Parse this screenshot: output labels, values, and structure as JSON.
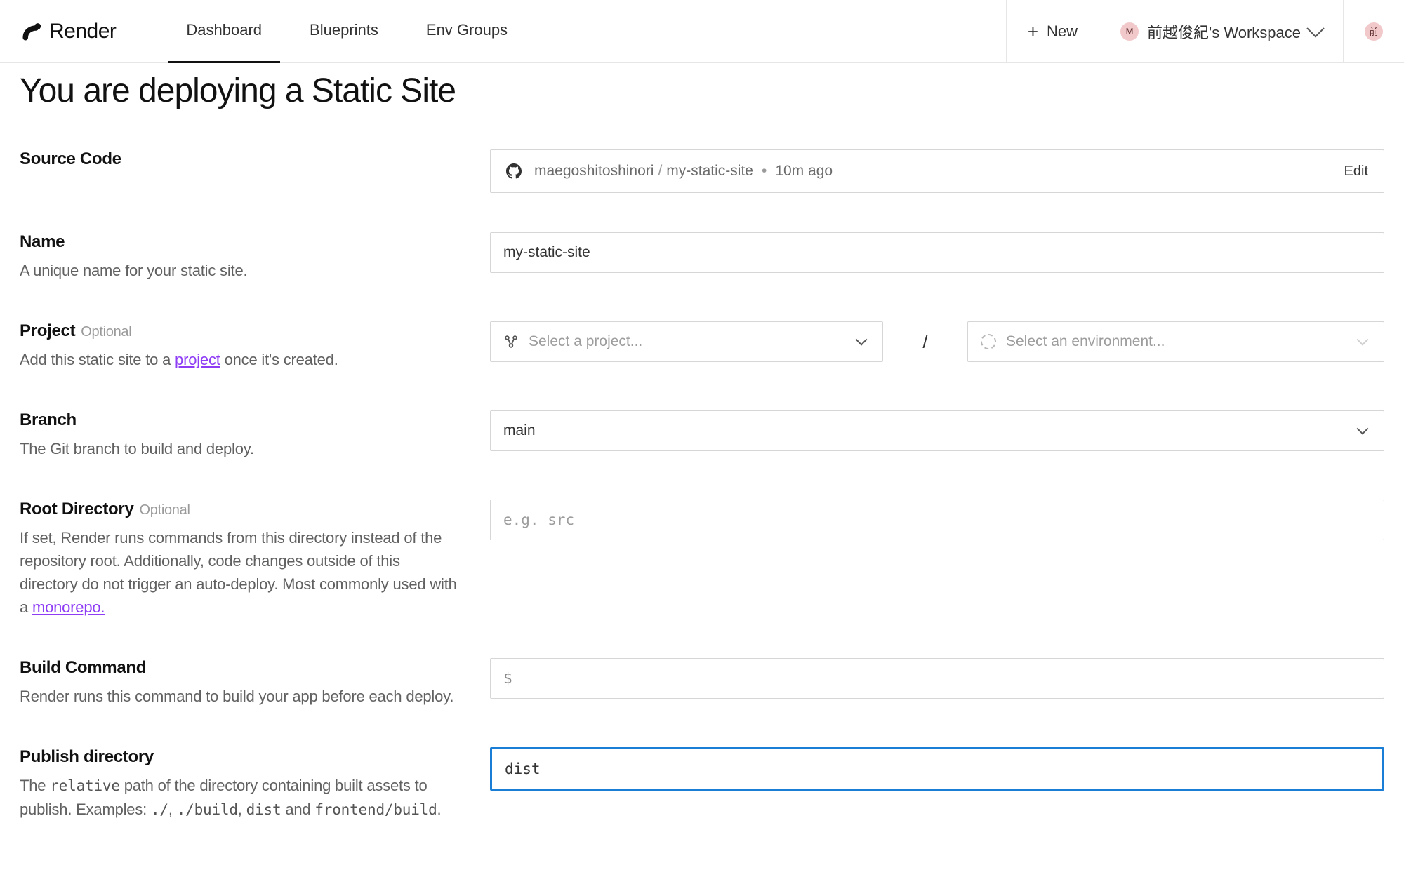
{
  "brand": "Render",
  "nav": {
    "dashboard": "Dashboard",
    "blueprints": "Blueprints",
    "env_groups": "Env Groups"
  },
  "header": {
    "new_label": "New",
    "workspace_badge": "M",
    "workspace_name": "前越俊紀's Workspace",
    "avatar_badge": "前"
  },
  "page_title": "You are deploying a Static Site",
  "source": {
    "label": "Source Code",
    "owner": "maegoshitoshinori",
    "repo": "my-static-site",
    "ago": "10m ago",
    "edit": "Edit"
  },
  "name": {
    "label": "Name",
    "desc": "A unique name for your static site.",
    "value": "my-static-site"
  },
  "project": {
    "label": "Project",
    "optional": "Optional",
    "desc_before": "Add this static site to a ",
    "desc_link": "project",
    "desc_after": " once it's created.",
    "placeholder": "Select a project...",
    "env_placeholder": "Select an environment...",
    "slash": "/"
  },
  "branch": {
    "label": "Branch",
    "desc": "The Git branch to build and deploy.",
    "value": "main"
  },
  "rootdir": {
    "label": "Root Directory",
    "optional": "Optional",
    "desc_before": "If set, Render runs commands from this directory instead of the repository root. Additionally, code changes outside of this directory do not trigger an auto-deploy. Most commonly used with a ",
    "desc_link": "monorepo.",
    "placeholder": "e.g. src"
  },
  "build": {
    "label": "Build Command",
    "desc": "Render runs this command to build your app before each deploy.",
    "dollar": "$",
    "value": ""
  },
  "publish": {
    "label": "Publish directory",
    "desc_1": "The ",
    "desc_code1": "relative",
    "desc_2": " path of the directory containing built assets to publish. Examples: ",
    "ex1": "./",
    "comma1": ", ",
    "ex2": "./build",
    "comma2": ", ",
    "ex3": "dist",
    "and": " and ",
    "ex4": "frontend/build",
    "period": ".",
    "value": "dist"
  }
}
